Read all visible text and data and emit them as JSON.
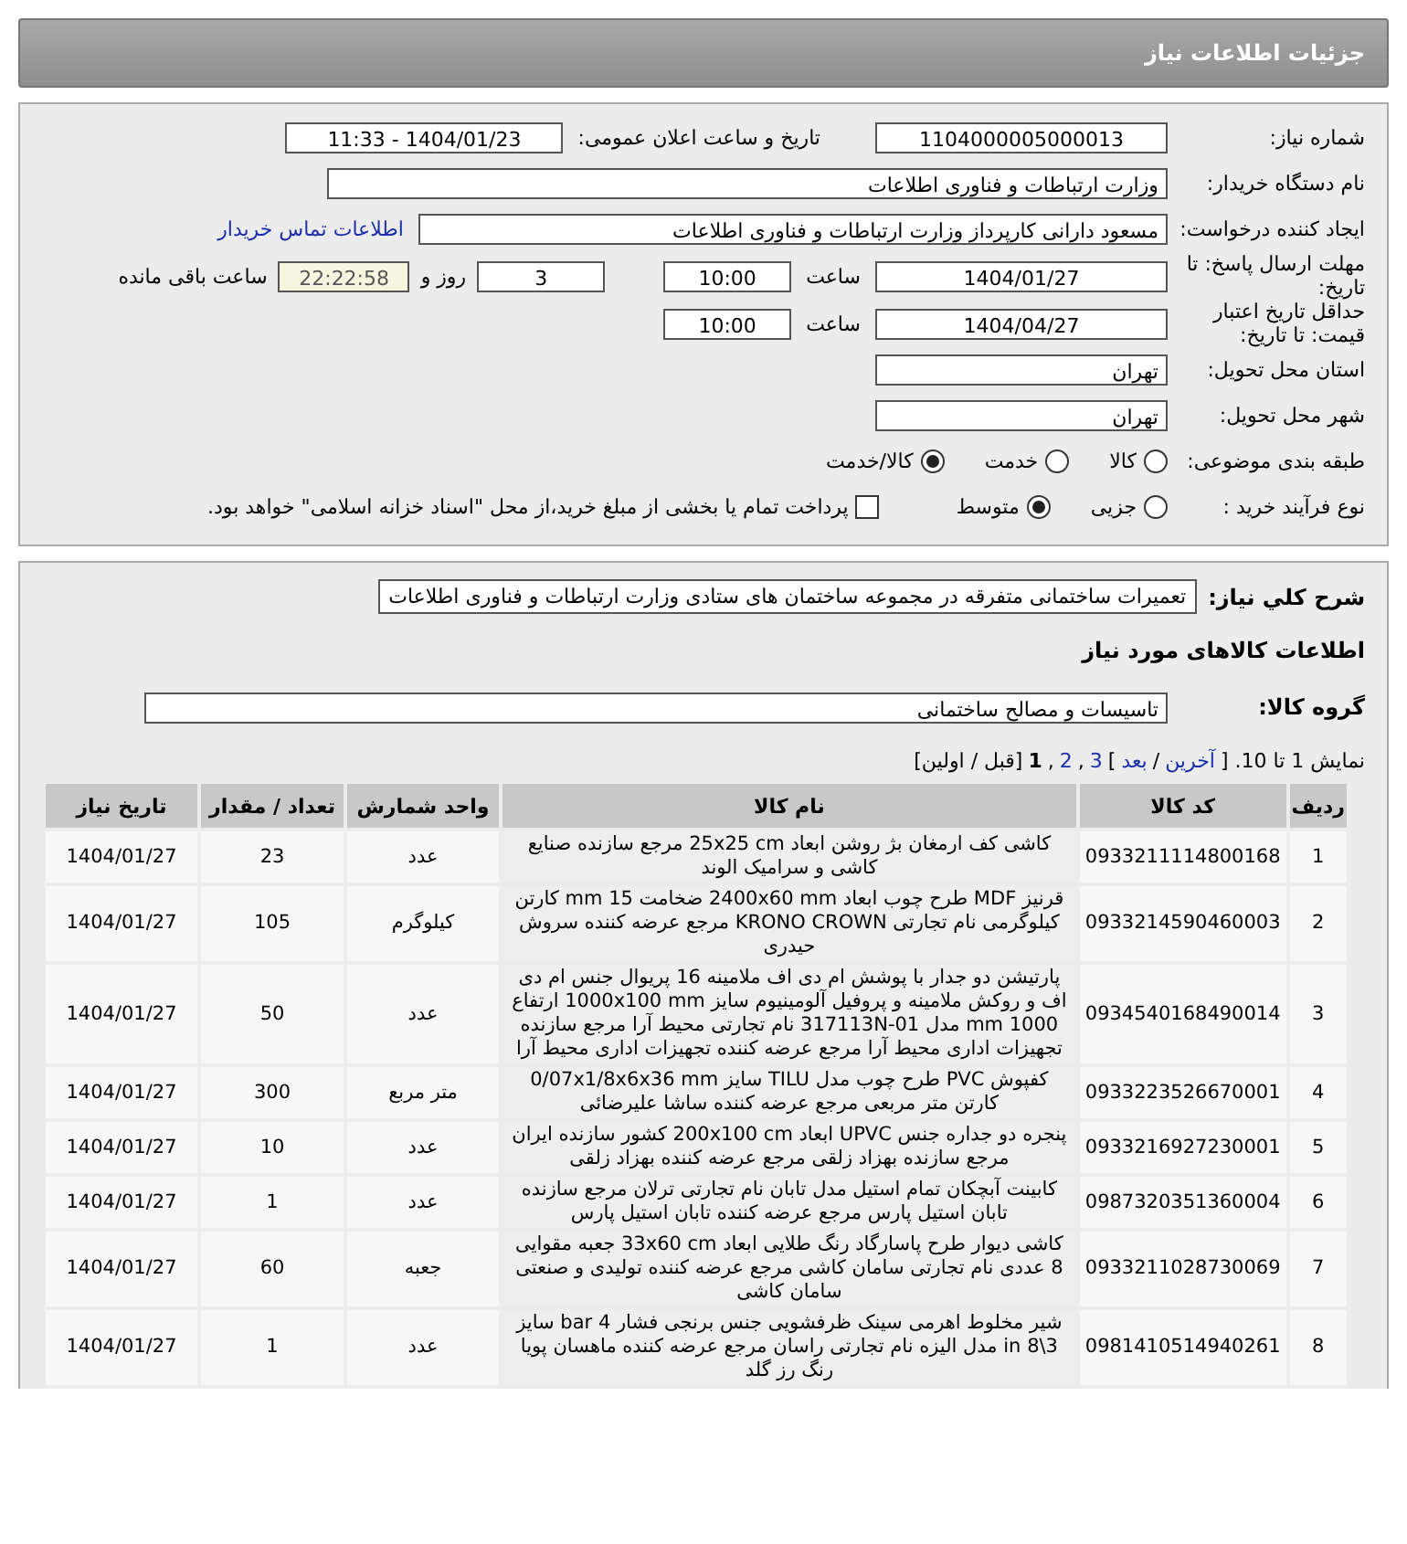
{
  "header": {
    "title": "جزئیات اطلاعات نیاز"
  },
  "general": {
    "need_number": {
      "label": "شماره نیاز:",
      "value": "1104000005000013"
    },
    "announce": {
      "label": "تاریخ و ساعت اعلان عمومی:",
      "value": "1404/01/23 - 11:33"
    },
    "buyer": {
      "label": "نام دستگاه خریدار:",
      "value": "وزارت ارتباطات و فناوری اطلاعات"
    },
    "requester": {
      "label": "ایجاد کننده درخواست:",
      "value": "مسعود دارانی کارپرداز وزارت ارتباطات و فناوری اطلاعات",
      "link": "اطلاعات تماس خریدار"
    },
    "deadline": {
      "label": "مهلت ارسال پاسخ: تا تاریخ:",
      "date": "1404/01/27",
      "time_label": "ساعت",
      "time": "10:00",
      "days": "3",
      "days_label": "روز و",
      "remaining": "22:22:58",
      "remaining_label": "ساعت باقی مانده"
    },
    "validity": {
      "label": "حداقل تاریخ اعتبار قیمت: تا تاریخ:",
      "date": "1404/04/27",
      "time_label": "ساعت",
      "time": "10:00"
    },
    "province": {
      "label": "استان محل تحویل:",
      "value": "تهران"
    },
    "city": {
      "label": "شهر محل تحویل:",
      "value": "تهران"
    },
    "category": {
      "label": "طبقه بندی موضوعی:",
      "options": [
        {
          "label": "کالا",
          "selected": false
        },
        {
          "label": "خدمت",
          "selected": false
        },
        {
          "label": "کالا/خدمت",
          "selected": true
        }
      ]
    },
    "process": {
      "label": "نوع فرآیند خرید :",
      "options": [
        {
          "label": "جزیی",
          "selected": false
        },
        {
          "label": "متوسط",
          "selected": true
        }
      ],
      "treasury": {
        "label": "پرداخت تمام یا بخشی از مبلغ خرید،از محل \"اسناد خزانه اسلامی\" خواهد بود.",
        "checked": false
      }
    }
  },
  "items": {
    "description": {
      "label": "شرح کلي نیاز:",
      "value": "تعمیرات ساختمانی متفرقه در مجموعه ساختمان های ستادی وزارت ارتباطات و فناوری اطلاعات"
    },
    "heading": "اطلاعات کالاهای مورد نیاز",
    "group": {
      "label": "گروه کالا:",
      "value": "تاسیسات و مصالح ساختمانی"
    },
    "pager": [
      {
        "kind": "text",
        "text": "نمایش 1 تا 10. ["
      },
      {
        "kind": "link",
        "text": "آخرین"
      },
      {
        "kind": "text",
        "text": "/"
      },
      {
        "kind": "link",
        "text": "بعد"
      },
      {
        "kind": "text",
        "text": "]"
      },
      {
        "kind": "link",
        "text": "3"
      },
      {
        "kind": "text",
        "text": ","
      },
      {
        "kind": "link",
        "text": "2"
      },
      {
        "kind": "text",
        "text": ","
      },
      {
        "kind": "current",
        "text": "1"
      },
      {
        "kind": "text",
        "text": "[قبل / اولین]"
      }
    ],
    "table": {
      "columns": [
        "ردیف",
        "کد کالا",
        "نام کالا",
        "واحد شمارش",
        "تعداد / مقدار",
        "تاریخ نیاز"
      ],
      "rows": [
        [
          "1",
          "0933211114800168",
          "کاشی کف ارمغان بژ روشن ابعاد 25x25 cm مرجع سازنده صنایع کاشی و سرامیک الوند",
          "عدد",
          "23",
          "1404/01/27"
        ],
        [
          "2",
          "0933214590460003",
          "قرنیز MDF طرح چوب ابعاد 2400x60 mm ضخامت 15 mm کارتن کیلوگرمی نام تجارتی KRONO CROWN مرجع عرضه کننده سروش حیدری",
          "کیلوگرم",
          "105",
          "1404/01/27"
        ],
        [
          "3",
          "0934540168490014",
          "پارتیشن دو جدار با پوشش ام دی اف ملامینه 16 پریوال جنس ام دی اف و روکش ملامینه و پروفیل آلومینیوم سایز 1000x100 mm ارتفاع 1000 mm مدل 317113N-01 نام تجارتی محیط آرا مرجع سازنده تجهیزات اداری محیط آرا مرجع عرضه کننده تجهیزات اداری محیط آرا",
          "عدد",
          "50",
          "1404/01/27"
        ],
        [
          "4",
          "0933223526670001",
          "کفپوش PVC طرح چوب مدل TILU سایز 0/07x1/8x6x36 mm کارتن متر مربعی مرجع عرضه کننده ساشا علیرضائی",
          "متر مربع",
          "300",
          "1404/01/27"
        ],
        [
          "5",
          "0933216927230001",
          "پنجره دو جداره جنس UPVC ابعاد 200x100 cm کشور سازنده ایران مرجع سازنده بهزاد زلقی مرجع عرضه کننده بهزاد زلقی",
          "عدد",
          "10",
          "1404/01/27"
        ],
        [
          "6",
          "0987320351360004",
          "کابینت آبچکان تمام استیل مدل تابان نام تجارتی ترلان مرجع سازنده تابان استیل پارس مرجع عرضه کننده تابان استیل پارس",
          "عدد",
          "1",
          "1404/01/27"
        ],
        [
          "7",
          "0933211028730069",
          "کاشی دیوار طرح پاسارگاد رنگ طلایی ابعاد 33x60 cm جعبه مقوایی 8 عددی نام تجارتی سامان کاشی مرجع عرضه کننده تولیدی و صنعتی سامان کاشی",
          "جعبه",
          "60",
          "1404/01/27"
        ],
        [
          "8",
          "0981410514940261",
          "شیر مخلوط اهرمی سینک ظرفشویی جنس برنجی فشار 4 bar سایز 3\\8 in مدل الیزه نام تجارتی راسان مرجع عرضه کننده ماهسان پویا رنگ رز گلد",
          "عدد",
          "1",
          "1404/01/27"
        ]
      ]
    }
  }
}
